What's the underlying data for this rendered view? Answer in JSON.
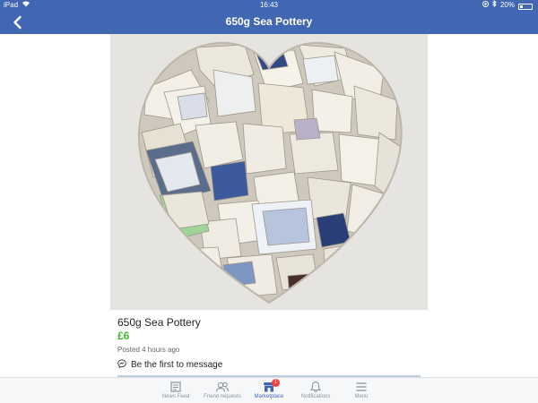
{
  "status_bar": {
    "device": "iPad",
    "time": "16:43",
    "battery": "20%"
  },
  "header": {
    "title": "650g Sea Pottery"
  },
  "listing": {
    "title": "650g Sea Pottery",
    "price": "£6",
    "posted": "Posted 4 hours ago",
    "message_prompt": "Be the first to message"
  },
  "tabs": [
    {
      "label": "News Feed",
      "icon": "news-feed-icon"
    },
    {
      "label": "Friend requests",
      "icon": "friend-requests-icon"
    },
    {
      "label": "Marketplace",
      "icon": "marketplace-icon",
      "badge": "1"
    },
    {
      "label": "Notifications",
      "icon": "bell-icon"
    },
    {
      "label": "Menu",
      "icon": "menu-icon"
    }
  ],
  "colors": {
    "brand": "#4267b2",
    "price": "#42b72a",
    "badge": "#fa3e3e"
  }
}
